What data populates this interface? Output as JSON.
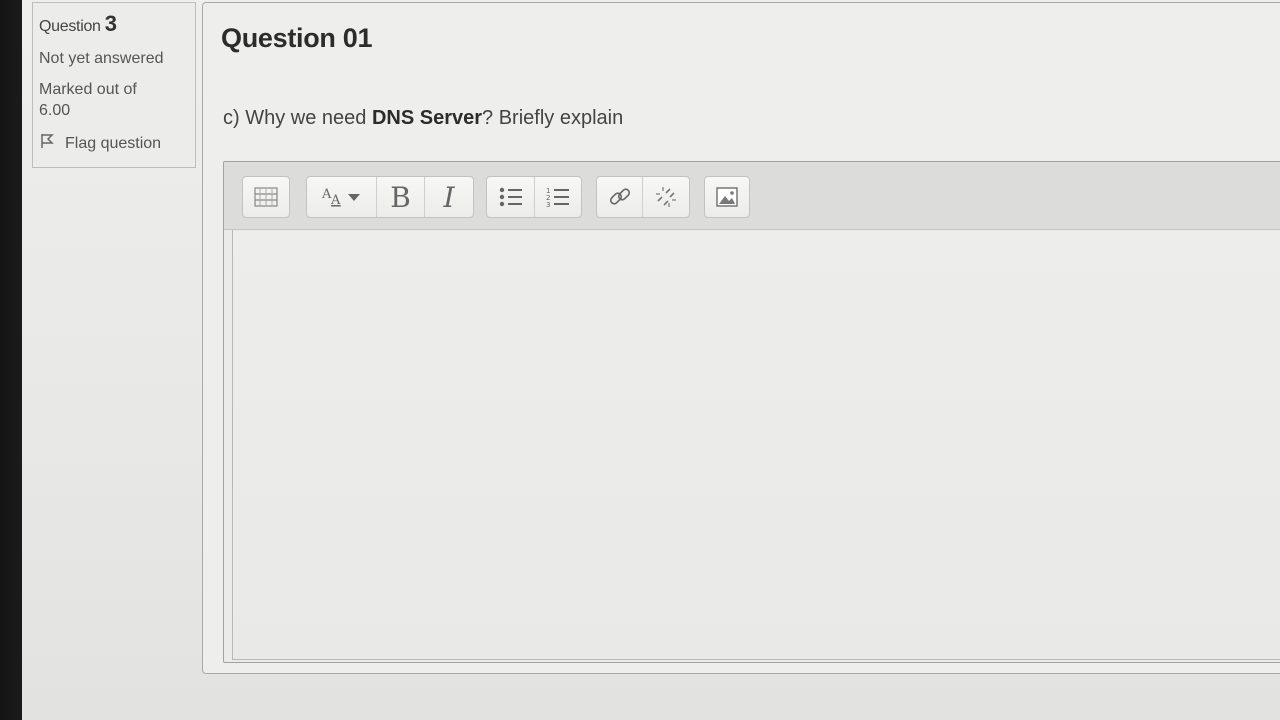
{
  "info": {
    "question_label": "Question",
    "question_number": "3",
    "status": "Not yet answered",
    "marks": "Marked out of 6.00",
    "flag_label": "Flag question",
    "flag_icon": "flag-icon"
  },
  "question": {
    "title": "Question 01",
    "prompt_prefix": "c) Why we need ",
    "prompt_bold": "DNS Server",
    "prompt_suffix": "? Briefly explain"
  },
  "editor": {
    "answer_text": "",
    "toolbar_icons": [
      "toolbar-toggle-icon",
      "font-style-icon",
      "bold-icon",
      "italic-icon",
      "unordered-list-icon",
      "ordered-list-icon",
      "link-icon",
      "unlink-icon",
      "image-icon"
    ]
  }
}
